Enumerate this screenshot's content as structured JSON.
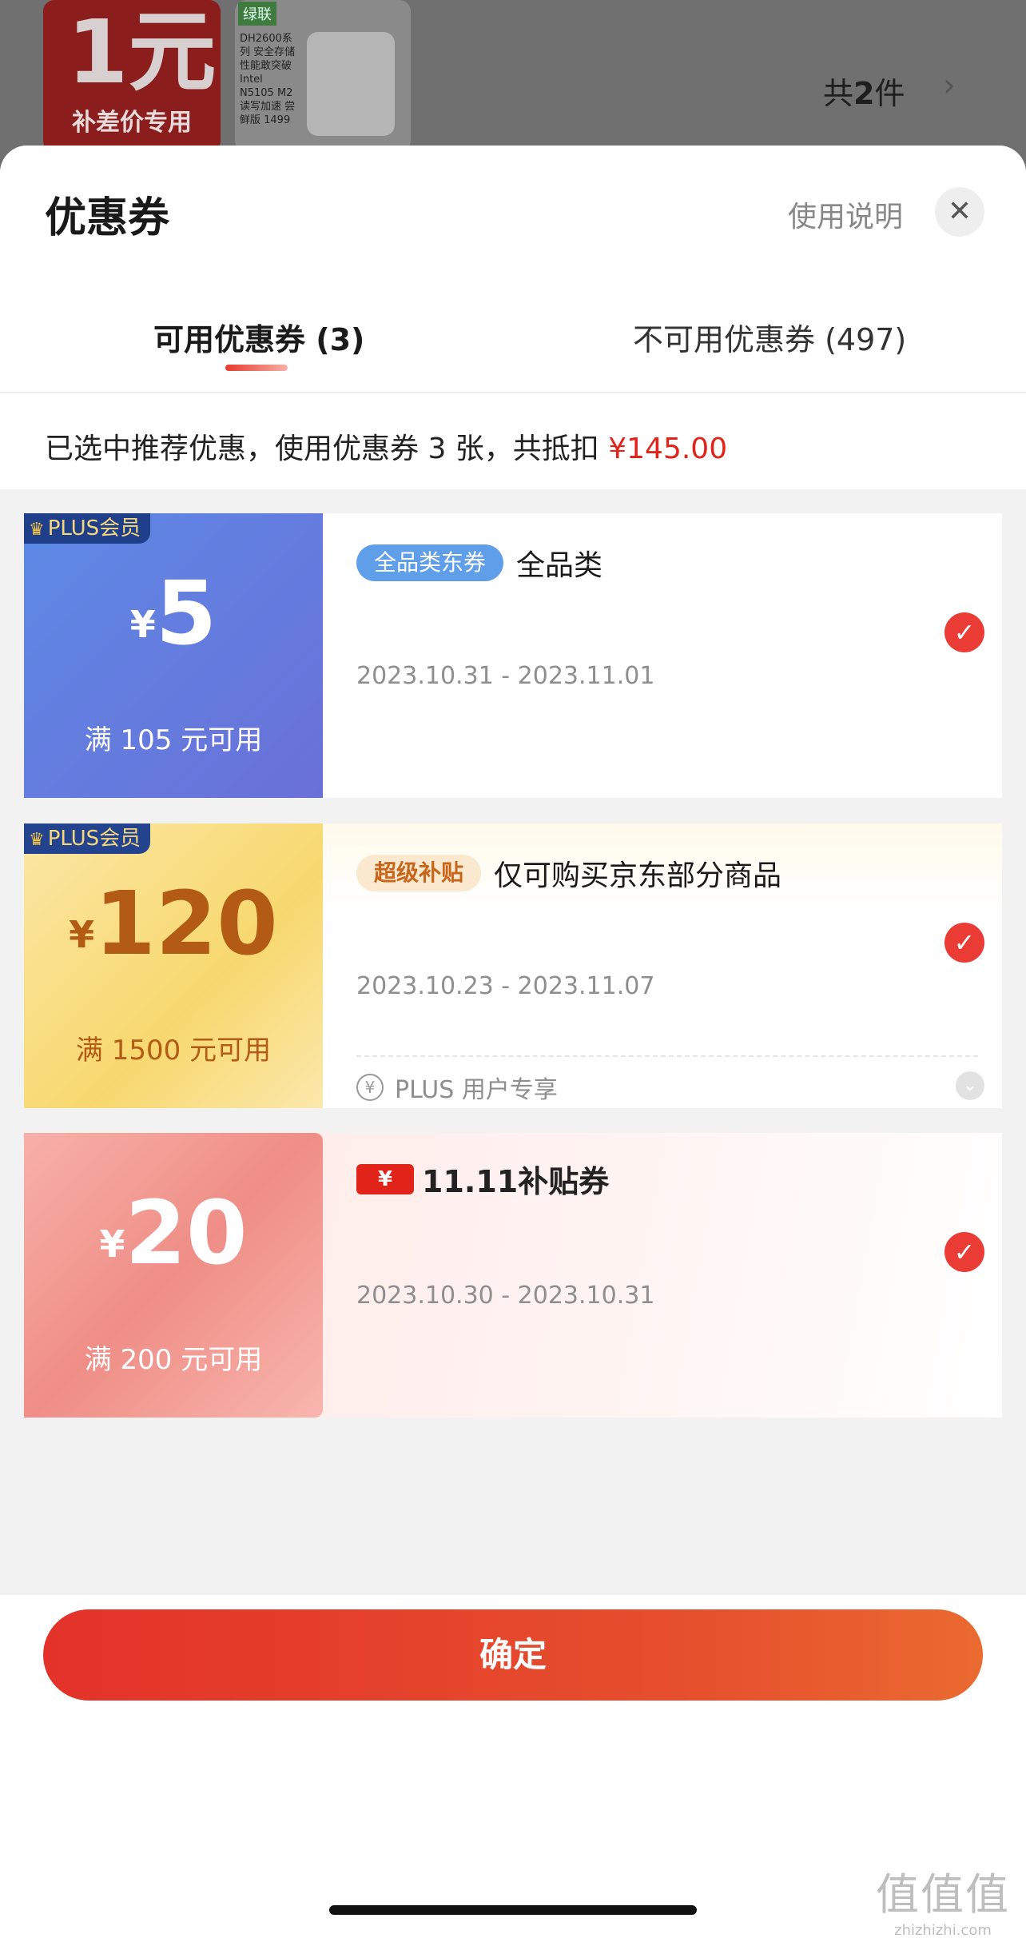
{
  "background": {
    "thumb1_big": "1元",
    "thumb1_sub": "补差价专用",
    "thumb2_brand": "绿联",
    "thumb2_spec": "DH2600系列 安全存储 性能敢突破 Intel N5105 M2读写加速 尝鲜版 1499",
    "count_prefix": "共",
    "count_num": "2",
    "count_suffix": "件",
    "chevron": "›"
  },
  "sheet": {
    "title": "优惠券",
    "help_label": "使用说明",
    "close_icon": "✕",
    "tabs": [
      {
        "label": "可用优惠券 (3)",
        "active": true
      },
      {
        "label": "不可用优惠券 (497)",
        "active": false
      }
    ],
    "summary_text": "已选中推荐优惠，使用优惠券 3 张，共抵扣 ",
    "summary_amount": "¥145.00"
  },
  "coupons": [
    {
      "badge": "PLUS会员",
      "yen": "¥",
      "amount": "5",
      "condition": "满 105 元可用",
      "tag": "全品类东券",
      "title": "全品类",
      "dates": "2023.10.31 - 2023.11.01",
      "checked": true
    },
    {
      "badge": "PLUS会员",
      "yen": "¥",
      "amount": "120",
      "condition": "满 1500 元可用",
      "tag": "超级补贴",
      "title": "仅可购买京东部分商品",
      "dates": "2023.10.23 - 2023.11.07",
      "plus_note": "PLUS 用户专享",
      "checked": true
    },
    {
      "yen": "¥",
      "amount": "20",
      "condition": "满 200 元可用",
      "logo_ticket": "¥",
      "logo_text": "11.11补贴券",
      "dates": "2023.10.30 - 2023.10.31",
      "checked": true
    }
  ],
  "footer": {
    "confirm_label": "确定",
    "watermark_logo": "值值值",
    "watermark_site": "zhizhizhi.com"
  },
  "colors": {
    "accent_red": "#e2231a",
    "check_red": "#ea3b35",
    "plus_blue": "#1f3f8a",
    "gold_text": "#b35b14"
  }
}
